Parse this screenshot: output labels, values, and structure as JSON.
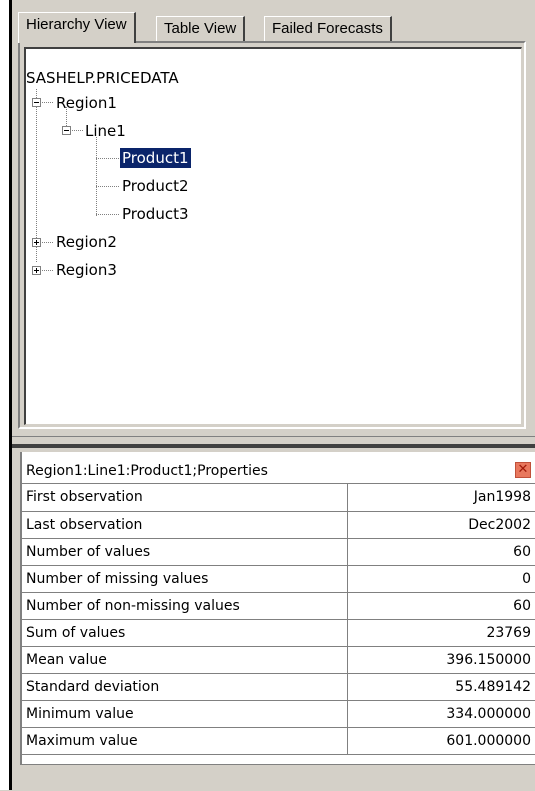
{
  "tabs": [
    {
      "label": "Hierarchy View",
      "active": true
    },
    {
      "label": "Table View",
      "active": false
    },
    {
      "label": "Failed Forecasts",
      "active": false
    }
  ],
  "tree": {
    "root": "SASHELP.PRICEDATA",
    "region1": {
      "label": "Region1",
      "expanded": true
    },
    "line1": {
      "label": "Line1",
      "expanded": true
    },
    "products": [
      {
        "label": "Product1",
        "selected": true
      },
      {
        "label": "Product2",
        "selected": false
      },
      {
        "label": "Product3",
        "selected": false
      }
    ],
    "region2": {
      "label": "Region2",
      "expanded": false
    },
    "region3": {
      "label": "Region3",
      "expanded": false
    }
  },
  "properties": {
    "title": "Region1:Line1:Product1;Properties",
    "close_glyph": "✕",
    "rows": [
      {
        "name": "First observation",
        "value": "Jan1998"
      },
      {
        "name": "Last observation",
        "value": "Dec2002"
      },
      {
        "name": "Number of values",
        "value": "60"
      },
      {
        "name": "Number of missing values",
        "value": "0"
      },
      {
        "name": "Number of non-missing values",
        "value": "60"
      },
      {
        "name": "Sum of values",
        "value": "23769"
      },
      {
        "name": "Mean value",
        "value": "396.150000"
      },
      {
        "name": "Standard deviation",
        "value": "55.489142"
      },
      {
        "name": "Minimum value",
        "value": "334.000000"
      },
      {
        "name": "Maximum value",
        "value": "601.000000"
      }
    ]
  },
  "colors": {
    "selection": "#0a246a",
    "face": "#d4d0c8",
    "close": "#e8785e"
  }
}
